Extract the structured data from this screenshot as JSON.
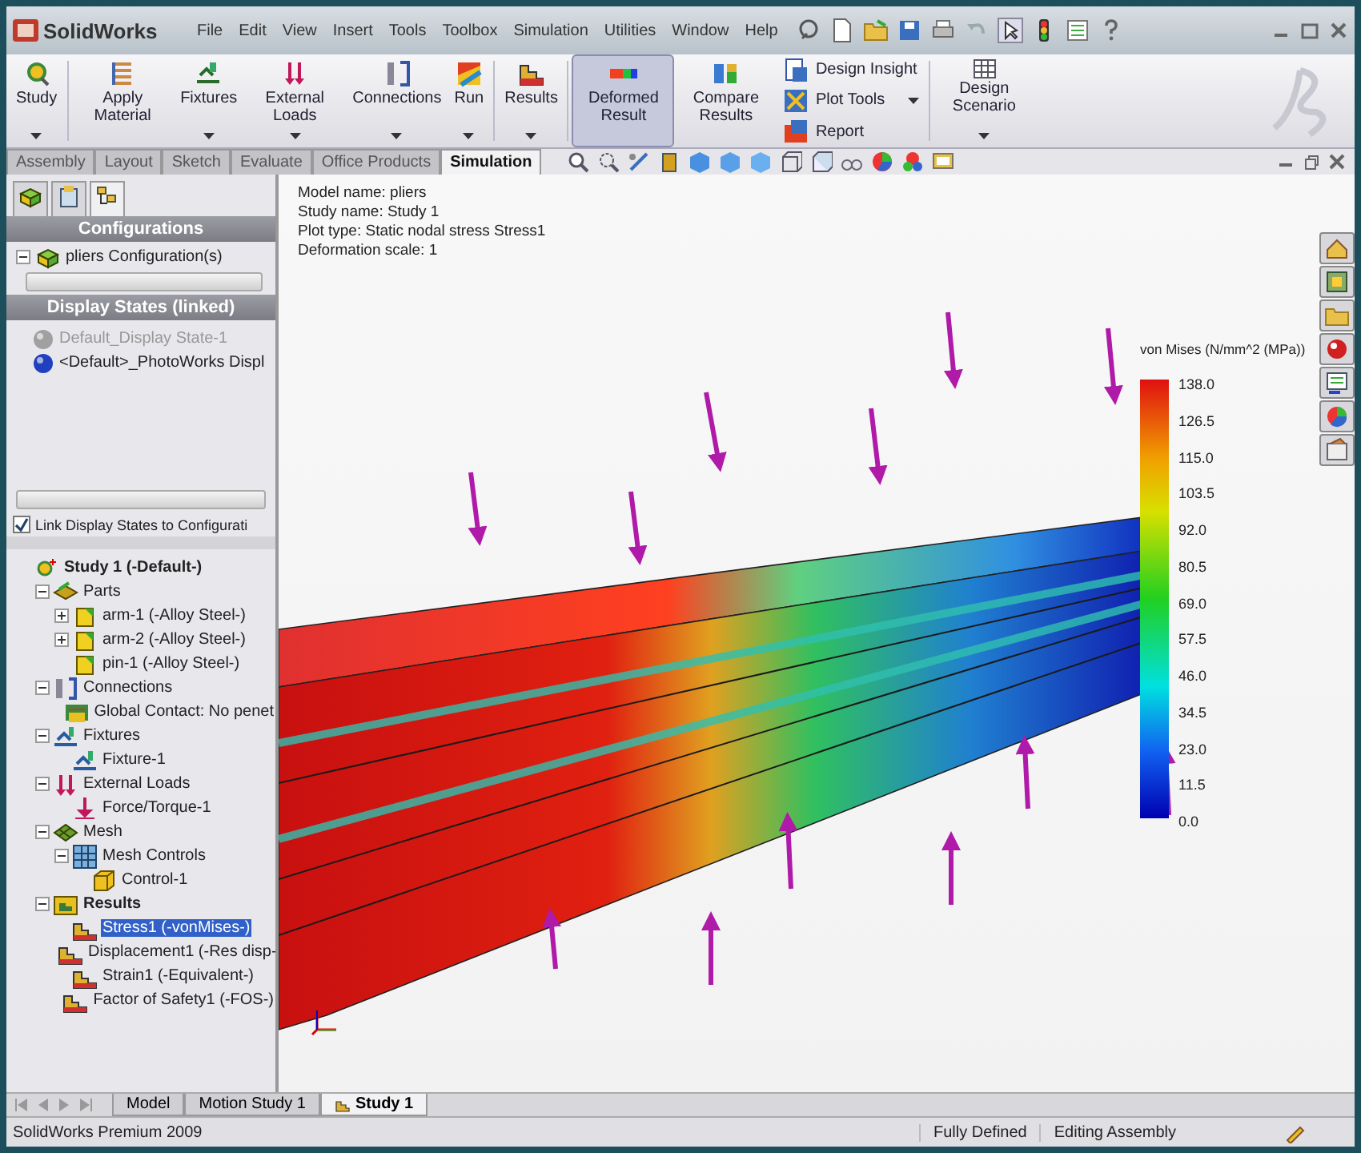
{
  "app": {
    "name": "SolidWorks"
  },
  "menu": [
    "File",
    "Edit",
    "View",
    "Insert",
    "Tools",
    "Toolbox",
    "Simulation",
    "Utilities",
    "Window",
    "Help"
  ],
  "ribbon": {
    "buttons": [
      {
        "label": "Study",
        "kind": "study",
        "selected": false,
        "dropdown": true
      },
      {
        "label": "Apply Material",
        "kind": "material",
        "selected": false,
        "dropdown": false
      },
      {
        "label": "Fixtures",
        "kind": "fixtures",
        "selected": false,
        "dropdown": true
      },
      {
        "label": "External Loads",
        "kind": "loads",
        "selected": false,
        "dropdown": true
      },
      {
        "label": "Connections",
        "kind": "connections",
        "selected": false,
        "dropdown": true
      },
      {
        "label": "Run",
        "kind": "run",
        "selected": false,
        "dropdown": true
      },
      {
        "label": "Results",
        "kind": "results",
        "selected": false,
        "dropdown": true
      },
      {
        "label": "Deformed Result",
        "kind": "deformed",
        "selected": true,
        "dropdown": false
      },
      {
        "label": "Compare Results",
        "kind": "compare",
        "selected": false,
        "dropdown": false
      }
    ],
    "small_buttons": [
      "Design Insight",
      "Plot Tools",
      "Report"
    ],
    "scenario": {
      "label": "Design Scenario"
    }
  },
  "tabs": [
    {
      "label": "Assembly",
      "selected": false
    },
    {
      "label": "Layout",
      "selected": false
    },
    {
      "label": "Sketch",
      "selected": false
    },
    {
      "label": "Evaluate",
      "selected": false
    },
    {
      "label": "Office Products",
      "selected": false
    },
    {
      "label": "Simulation",
      "selected": true
    }
  ],
  "config_panel": {
    "configurations_title": "Configurations",
    "configuration": {
      "label": "pliers Configuration(s)",
      "expanded": true
    },
    "display_states_title": "Display States (linked)",
    "display_states": [
      {
        "label": "Default_Display State-1",
        "active": false
      },
      {
        "label": "<Default>_PhotoWorks Displ",
        "active": true
      }
    ],
    "link_checkbox": {
      "label": "Link Display States to Configurati",
      "checked": true
    }
  },
  "study_tree": [
    {
      "label": "Study 1 (-Default-)",
      "kind": "study",
      "bold": true,
      "selected": false,
      "children": [
        {
          "label": "Parts",
          "kind": "parts",
          "expanded": true,
          "selected": false,
          "children": [
            {
              "label": "arm-1 (-Alloy Steel-)",
              "kind": "part",
              "expanded": false,
              "selected": false
            },
            {
              "label": "arm-2 (-Alloy Steel-)",
              "kind": "part",
              "expanded": false,
              "selected": false
            },
            {
              "label": "pin-1 (-Alloy Steel-)",
              "kind": "part",
              "selected": false
            }
          ]
        },
        {
          "label": "Connections",
          "kind": "connections",
          "expanded": true,
          "selected": false,
          "children": [
            {
              "label": "Global Contact: No penet",
              "kind": "contact",
              "selected": false
            }
          ]
        },
        {
          "label": "Fixtures",
          "kind": "fixtures",
          "expanded": true,
          "selected": false,
          "children": [
            {
              "label": "Fixture-1",
              "kind": "fixture",
              "selected": false
            }
          ]
        },
        {
          "label": "External Loads",
          "kind": "loads",
          "expanded": true,
          "selected": false,
          "children": [
            {
              "label": "Force/Torque-1",
              "kind": "force",
              "selected": false
            }
          ]
        },
        {
          "label": "Mesh",
          "kind": "mesh",
          "expanded": true,
          "selected": false,
          "children": [
            {
              "label": "Mesh Controls",
              "kind": "meshcontrols",
              "expanded": true,
              "selected": false,
              "children": [
                {
                  "label": "Control-1",
                  "kind": "control",
                  "selected": false
                }
              ]
            }
          ]
        },
        {
          "label": "Results",
          "kind": "results",
          "bold": true,
          "expanded": true,
          "selected": false,
          "children": [
            {
              "label": "Stress1 (-vonMises-)",
              "kind": "plot",
              "selected": true
            },
            {
              "label": "Displacement1 (-Res disp-",
              "kind": "plot",
              "selected": false
            },
            {
              "label": "Strain1 (-Equivalent-)",
              "kind": "plot",
              "selected": false
            },
            {
              "label": "Factor of Safety1 (-FOS-)",
              "kind": "plot",
              "selected": false
            }
          ]
        }
      ]
    }
  ],
  "plot_info": [
    "Model name: pliers",
    "Study name: Study 1",
    "Plot type: Static nodal stress Stress1",
    "Deformation scale: 1"
  ],
  "legend": {
    "title": "von Mises (N/mm^2 (MPa))",
    "labels": [
      "138.0",
      "126.5",
      "115.0",
      "103.5",
      "92.0",
      "80.5",
      "69.0",
      "57.5",
      "46.0",
      "34.5",
      "23.0",
      "11.5",
      "0.0"
    ]
  },
  "bottom_tabs": [
    {
      "label": "Model",
      "selected": false
    },
    {
      "label": "Motion Study 1",
      "selected": false
    },
    {
      "label": "Study 1",
      "selected": true
    }
  ],
  "status_bar": {
    "product": "SolidWorks Premium 2009",
    "state": "Fully Defined",
    "mode": "Editing Assembly"
  }
}
